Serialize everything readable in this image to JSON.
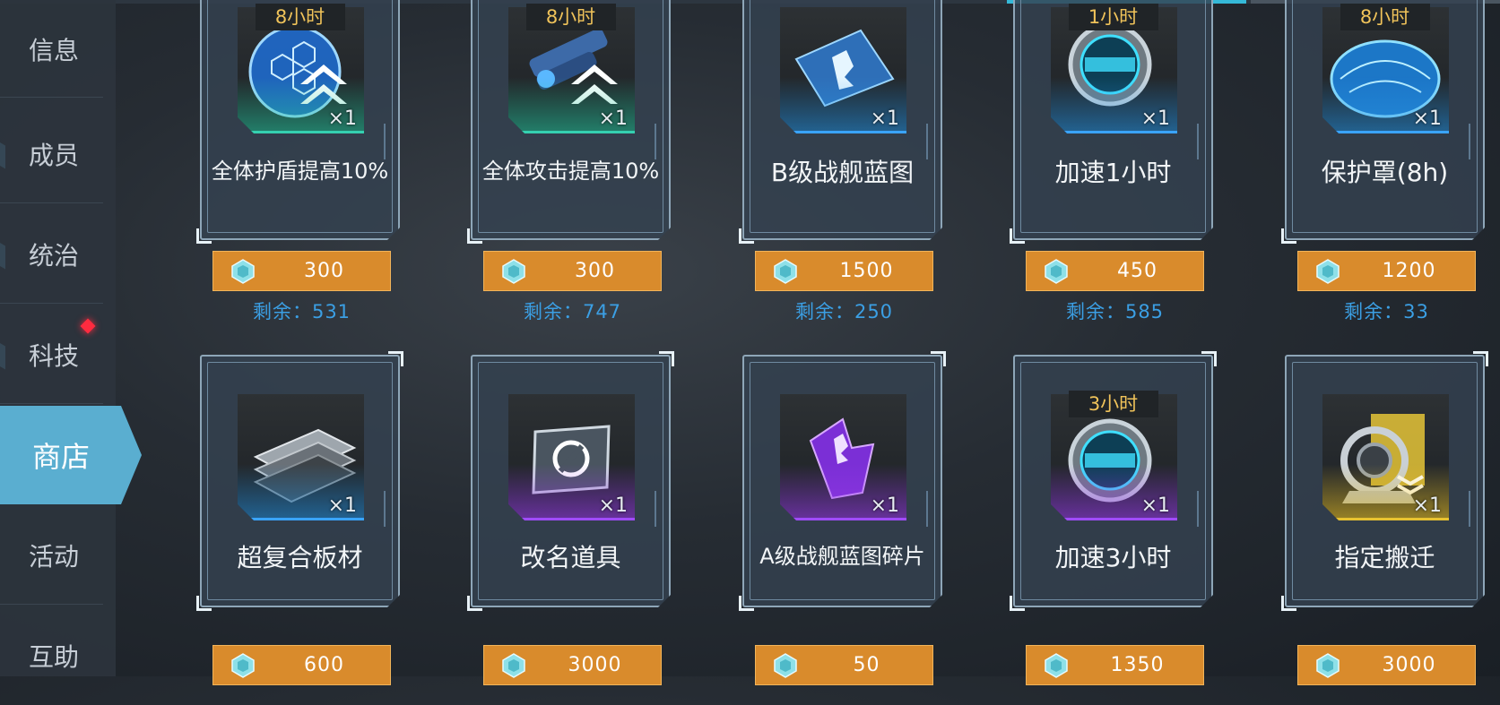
{
  "sidebar": {
    "items": [
      {
        "label": "信息"
      },
      {
        "label": "成员"
      },
      {
        "label": "统治"
      },
      {
        "label": "科技"
      },
      {
        "label": "商店",
        "active": true
      },
      {
        "label": "活动"
      },
      {
        "label": "互助"
      }
    ]
  },
  "shop": {
    "items": [
      {
        "name": "全体护盾提高10%",
        "tag": "8小时",
        "qty": "×1",
        "price": "300",
        "remain_label": "剩余：",
        "remain": "531",
        "icon": "shield-boost-icon",
        "rarity_color": "#35d0b0"
      },
      {
        "name": "全体攻击提高10%",
        "tag": "8小时",
        "qty": "×1",
        "price": "300",
        "remain_label": "剩余：",
        "remain": "747",
        "icon": "attack-boost-icon",
        "rarity_color": "#35d0b0"
      },
      {
        "name": "B级战舰蓝图",
        "tag": "",
        "qty": "×1",
        "price": "1500",
        "remain_label": "剩余：",
        "remain": "250",
        "icon": "blueprint-icon",
        "rarity_color": "#3aa4ff"
      },
      {
        "name": "加速1小时",
        "tag": "1小时",
        "qty": "×1",
        "price": "450",
        "remain_label": "剩余：",
        "remain": "585",
        "icon": "speedup-clock-icon",
        "rarity_color": "#3aa4ff"
      },
      {
        "name": "保护罩(8h)",
        "tag": "8小时",
        "qty": "×1",
        "price": "1200",
        "remain_label": "剩余：",
        "remain": "33",
        "icon": "protection-dome-icon",
        "rarity_color": "#3aa4ff"
      },
      {
        "name": "超复合板材",
        "tag": "",
        "qty": "×1",
        "price": "600",
        "icon": "composite-plate-icon",
        "rarity_color": "#3aa4ff"
      },
      {
        "name": "改名道具",
        "tag": "",
        "qty": "×1",
        "price": "3000",
        "icon": "rename-card-icon",
        "rarity_color": "#a04cff"
      },
      {
        "name": "A级战舰蓝图碎片",
        "tag": "",
        "qty": "×1",
        "price": "50",
        "icon": "blueprint-fragment-icon",
        "rarity_color": "#a04cff"
      },
      {
        "name": "加速3小时",
        "tag": "3小时",
        "qty": "×1",
        "price": "1350",
        "icon": "speedup-clock-icon",
        "rarity_color": "#a04cff"
      },
      {
        "name": "指定搬迁",
        "tag": "",
        "qty": "×1",
        "price": "3000",
        "icon": "relocation-device-icon",
        "rarity_color": "#e8c231"
      }
    ]
  }
}
